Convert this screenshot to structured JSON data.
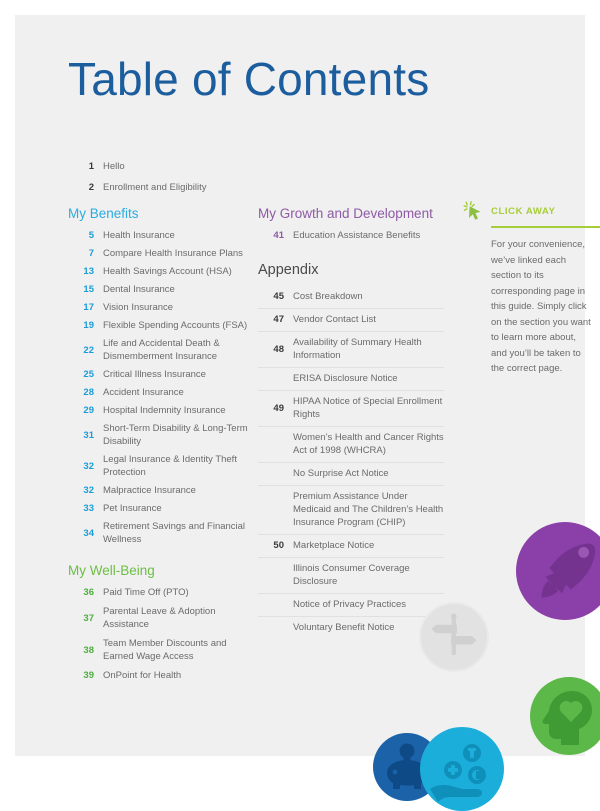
{
  "page": {
    "title": "Table of Contents"
  },
  "intro": {
    "items": [
      {
        "page": "1",
        "label": "Hello"
      },
      {
        "page": "2",
        "label": "Enrollment and Eligibility"
      }
    ]
  },
  "benefits": {
    "heading": "My Benefits",
    "color": "#2aace2",
    "items": [
      {
        "page": "5",
        "label": "Health Insurance"
      },
      {
        "page": "7",
        "label": "Compare Health Insurance Plans"
      },
      {
        "page": "13",
        "label": "Health Savings Account (HSA)"
      },
      {
        "page": "15",
        "label": "Dental Insurance"
      },
      {
        "page": "17",
        "label": "Vision Insurance"
      },
      {
        "page": "19",
        "label": "Flexible Spending Accounts (FSA)"
      },
      {
        "page": "22",
        "label": "Life and Accidental Death & Dismemberment Insurance"
      },
      {
        "page": "25",
        "label": "Critical Illness Insurance"
      },
      {
        "page": "28",
        "label": "Accident Insurance"
      },
      {
        "page": "29",
        "label": "Hospital Indemnity Insurance"
      },
      {
        "page": "31",
        "label": "Short-Term Disability & Long-Term Disability"
      },
      {
        "page": "32",
        "label": "Legal Insurance & Identity Theft Protection"
      },
      {
        "page": "32",
        "label": "Malpractice Insurance"
      },
      {
        "page": "33",
        "label": "Pet Insurance"
      },
      {
        "page": "34",
        "label": "Retirement Savings and Financial Wellness"
      }
    ]
  },
  "wellbeing": {
    "heading": "My Well-Being",
    "color": "#6cbe45",
    "items": [
      {
        "page": "36",
        "label": "Paid Time Off (PTO)"
      },
      {
        "page": "37",
        "label": "Parental Leave & Adoption Assistance"
      },
      {
        "page": "38",
        "label": "Team Member Discounts and Earned Wage Access"
      },
      {
        "page": "39",
        "label": "OnPoint for Health"
      }
    ]
  },
  "growth": {
    "heading": "My Growth and Development",
    "color": "#8e5aa6",
    "items": [
      {
        "page": "41",
        "label": "Education Assistance Benefits"
      }
    ]
  },
  "appendix": {
    "heading": "Appendix",
    "color": "#4a4a4a",
    "items": [
      {
        "page": "45",
        "label": "Cost Breakdown"
      },
      {
        "page": "47",
        "label": "Vendor Contact List"
      },
      {
        "page": "48",
        "label": "Availability of Summary Health Information"
      },
      {
        "page": "",
        "label": "ERISA Disclosure Notice"
      },
      {
        "page": "49",
        "label": "HIPAA Notice of Special Enrollment Rights"
      },
      {
        "page": "",
        "label": "Women’s Health and Cancer Rights Act of 1998 (WHCRA)"
      },
      {
        "page": "",
        "label": "No Surprise Act Notice"
      },
      {
        "page": "",
        "label": "Premium Assistance Under Medicaid and The Children’s Health Insurance Program (CHIP)"
      },
      {
        "page": "50",
        "label": "Marketplace Notice"
      },
      {
        "page": "",
        "label": "Illinois Consumer Coverage Disclosure"
      },
      {
        "page": "",
        "label": "Notice of Privacy Practices"
      },
      {
        "page": "",
        "label": "Voluntary Benefit Notice"
      }
    ]
  },
  "click_away": {
    "title": "CLICK AWAY",
    "accent": "#a6ce39",
    "body": "For your convenience, we’ve linked each section to its corresponding page in this guide. Simply click on the section you want to learn more about, and you’ll be taken to the correct page."
  },
  "decorations": [
    {
      "name": "rocket",
      "color": "#8b3fa8"
    },
    {
      "name": "signpost",
      "color": "#e2e2e2"
    },
    {
      "name": "head-heart",
      "color": "#5cb848"
    },
    {
      "name": "piggy-bank",
      "color": "#1b62a8"
    },
    {
      "name": "hand-coins",
      "color": "#1baedb"
    }
  ]
}
